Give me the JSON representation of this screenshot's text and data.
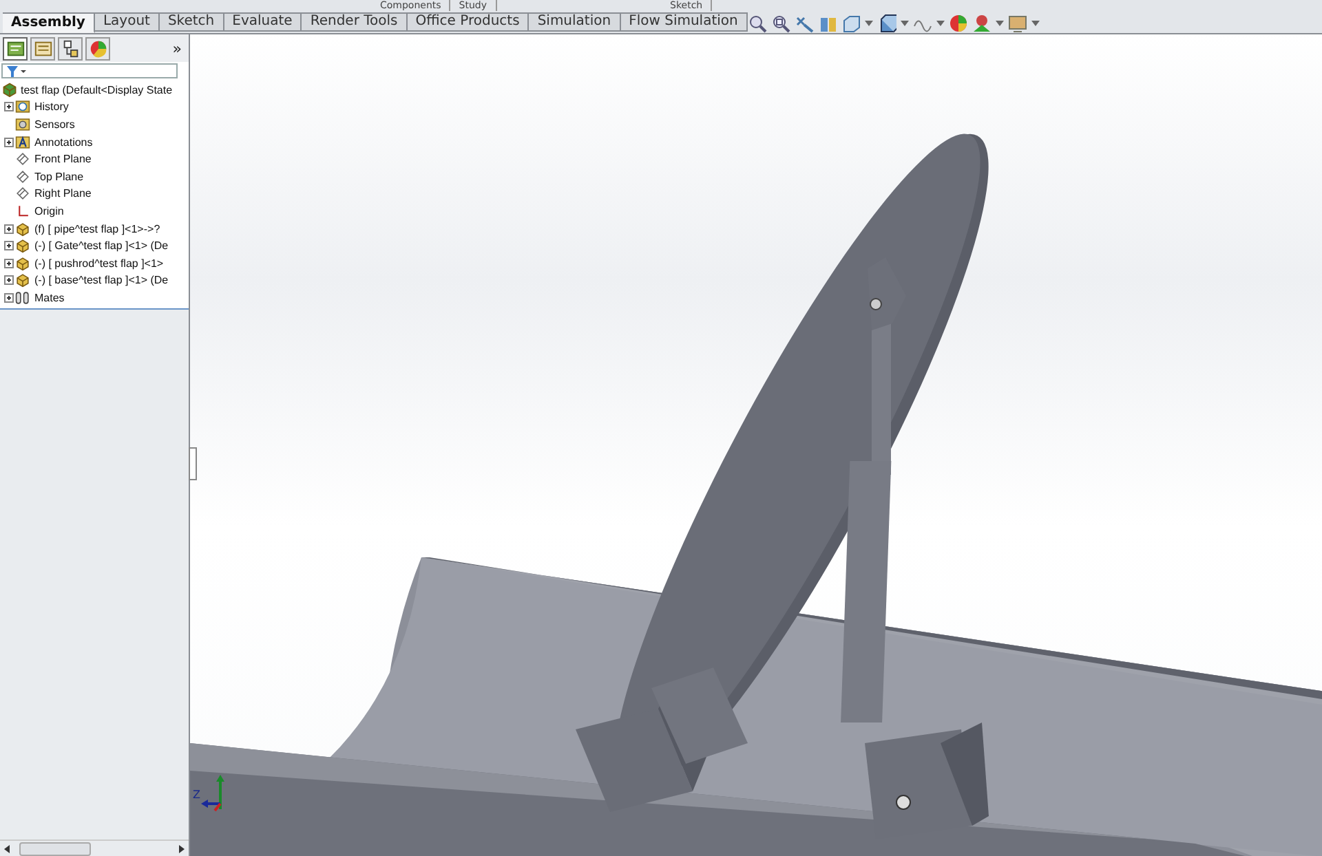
{
  "ribbon_groups": [
    {
      "label": "Components"
    },
    {
      "label": "Study"
    },
    {
      "label": "Sketch"
    }
  ],
  "tabs": [
    {
      "label": "Assembly",
      "selected": true
    },
    {
      "label": "Layout",
      "selected": false
    },
    {
      "label": "Sketch",
      "selected": false
    },
    {
      "label": "Evaluate",
      "selected": false
    },
    {
      "label": "Render Tools",
      "selected": false
    },
    {
      "label": "Office Products",
      "selected": false
    },
    {
      "label": "Simulation",
      "selected": false
    },
    {
      "label": "Flow Simulation",
      "selected": false
    }
  ],
  "panel_tabs": [
    {
      "kind": "tree",
      "selected": true
    },
    {
      "kind": "property",
      "selected": false
    },
    {
      "kind": "config",
      "selected": false
    },
    {
      "kind": "display",
      "selected": false
    }
  ],
  "panel_more": "»",
  "tree": {
    "root": "test flap  (Default<Display State",
    "items": [
      {
        "kind": "history",
        "label": "History",
        "expandable": true
      },
      {
        "kind": "sensors",
        "label": "Sensors",
        "expandable": false
      },
      {
        "kind": "annotations",
        "label": "Annotations",
        "expandable": true
      },
      {
        "kind": "plane",
        "label": "Front Plane",
        "expandable": false
      },
      {
        "kind": "plane",
        "label": "Top Plane",
        "expandable": false
      },
      {
        "kind": "plane",
        "label": "Right Plane",
        "expandable": false
      },
      {
        "kind": "origin",
        "label": "Origin",
        "expandable": false
      },
      {
        "kind": "part",
        "label": "(f) [ pipe^test flap ]<1>->?",
        "expandable": true
      },
      {
        "kind": "part",
        "label": "(-) [ Gate^test flap ]<1> (De",
        "expandable": true
      },
      {
        "kind": "part",
        "label": "(-) [ pushrod^test flap ]<1>",
        "expandable": true
      },
      {
        "kind": "part",
        "label": "(-) [ base^test flap ]<1> (De",
        "expandable": true
      },
      {
        "kind": "mates",
        "label": "Mates",
        "expandable": true
      }
    ]
  },
  "triad": {
    "axis_label": "Z"
  }
}
